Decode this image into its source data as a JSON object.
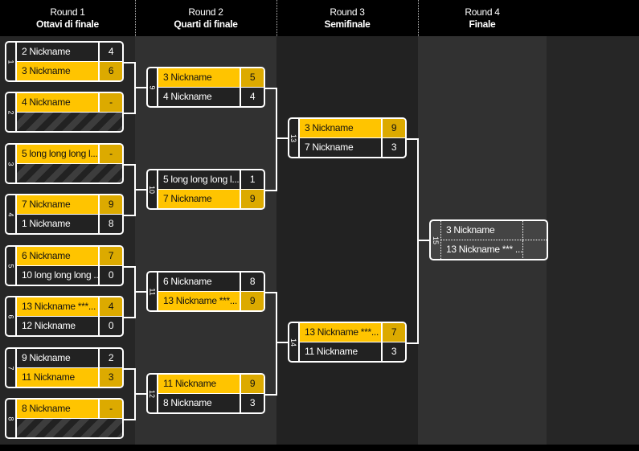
{
  "rounds": [
    {
      "title": "Round 1",
      "subtitle": "Ottavi di finale"
    },
    {
      "title": "Round 2",
      "subtitle": "Quarti di finale"
    },
    {
      "title": "Round 3",
      "subtitle": "Semifinale"
    },
    {
      "title": "Round 4",
      "subtitle": "Finale"
    }
  ],
  "colors": {
    "winner": "#ffc400",
    "winner_score": "#dcaa00",
    "loser": "#222222",
    "final": "#444444"
  },
  "matches": [
    {
      "id": "1",
      "round": 0,
      "teams": [
        {
          "name": "2 Nickname",
          "score": "4"
        },
        {
          "name": "3 Nickname",
          "score": "6",
          "winner": true
        }
      ]
    },
    {
      "id": "2",
      "round": 0,
      "teams": [
        {
          "name": "4 Nickname",
          "score": "-",
          "winner": true
        },
        {
          "empty": true
        }
      ]
    },
    {
      "id": "3",
      "round": 0,
      "teams": [
        {
          "name": "5 long long long l...",
          "score": "-",
          "winner": true
        },
        {
          "empty": true
        }
      ]
    },
    {
      "id": "4",
      "round": 0,
      "teams": [
        {
          "name": "7 Nickname",
          "score": "9",
          "winner": true
        },
        {
          "name": "1 Nickname",
          "score": "8"
        }
      ]
    },
    {
      "id": "5",
      "round": 0,
      "teams": [
        {
          "name": "6 Nickname",
          "score": "7",
          "winner": true
        },
        {
          "name": "10 long long long ...",
          "score": "0"
        }
      ]
    },
    {
      "id": "6",
      "round": 0,
      "teams": [
        {
          "name": "13 Nickname ***...",
          "score": "4",
          "winner": true
        },
        {
          "name": "12 Nickname",
          "score": "0"
        }
      ]
    },
    {
      "id": "7",
      "round": 0,
      "teams": [
        {
          "name": "9 Nickname",
          "score": "2"
        },
        {
          "name": "11 Nickname",
          "score": "3",
          "winner": true
        }
      ]
    },
    {
      "id": "8",
      "round": 0,
      "teams": [
        {
          "name": "8 Nickname",
          "score": "-",
          "winner": true
        },
        {
          "empty": true
        }
      ]
    },
    {
      "id": "9",
      "round": 1,
      "teams": [
        {
          "name": "3 Nickname",
          "score": "5",
          "winner": true
        },
        {
          "name": "4 Nickname",
          "score": "4"
        }
      ]
    },
    {
      "id": "10",
      "round": 1,
      "teams": [
        {
          "name": "5 long long long l...",
          "score": "1"
        },
        {
          "name": "7 Nickname",
          "score": "9",
          "winner": true
        }
      ]
    },
    {
      "id": "11",
      "round": 1,
      "teams": [
        {
          "name": "6 Nickname",
          "score": "8"
        },
        {
          "name": "13 Nickname ***...",
          "score": "9",
          "winner": true
        }
      ]
    },
    {
      "id": "12",
      "round": 1,
      "teams": [
        {
          "name": "11 Nickname",
          "score": "9",
          "winner": true
        },
        {
          "name": "8 Nickname",
          "score": "3"
        }
      ]
    },
    {
      "id": "13",
      "round": 2,
      "teams": [
        {
          "name": "3 Nickname",
          "score": "9",
          "winner": true
        },
        {
          "name": "7 Nickname",
          "score": "3"
        }
      ]
    },
    {
      "id": "14",
      "round": 2,
      "teams": [
        {
          "name": "13 Nickname ***...",
          "score": "7",
          "winner": true
        },
        {
          "name": "11 Nickname",
          "score": "3"
        }
      ]
    },
    {
      "id": "15",
      "round": 3,
      "final": true,
      "teams": [
        {
          "name": "3 Nickname",
          "score": ""
        },
        {
          "name": "13 Nickname *** ...",
          "score": ""
        }
      ]
    }
  ]
}
